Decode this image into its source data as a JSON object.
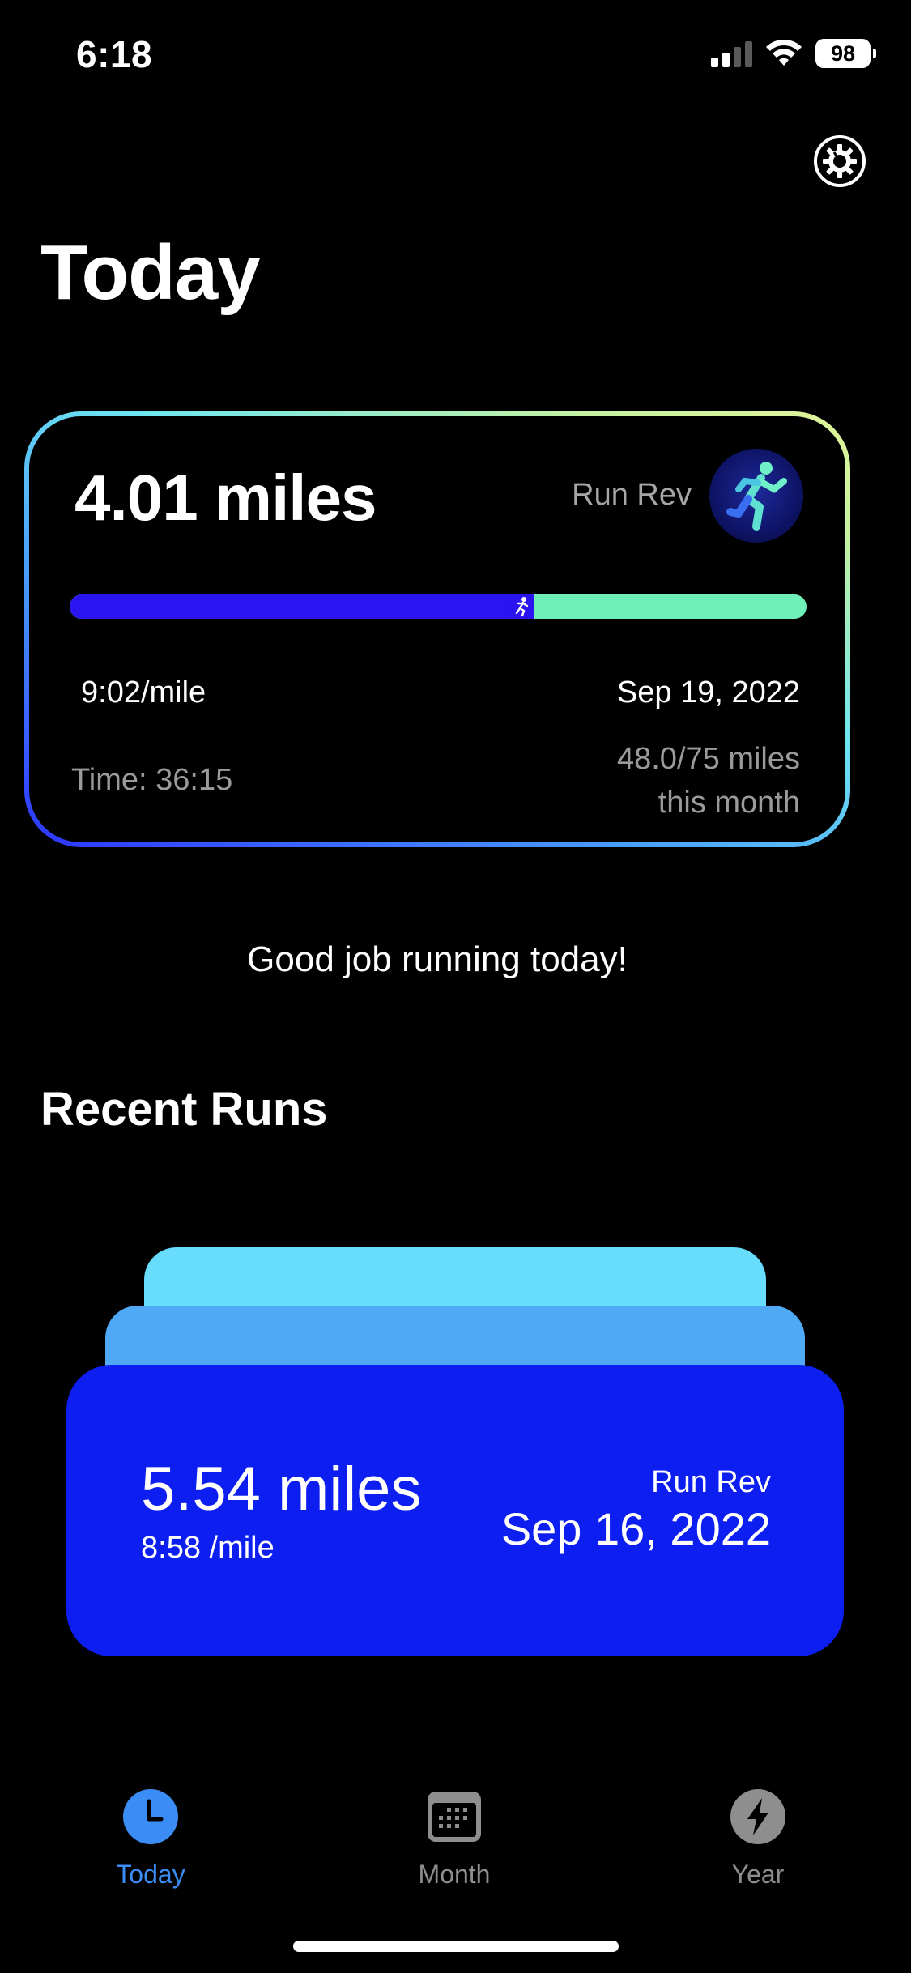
{
  "status_bar": {
    "time": "6:18",
    "battery": "98",
    "icons": [
      "cellular-signal-icon",
      "wifi-icon",
      "battery-icon"
    ]
  },
  "header": {
    "title": "Today",
    "settings_icon": "gear-icon"
  },
  "today_card": {
    "distance": "4.01 miles",
    "app_name": "Run Rev",
    "app_icon": "runner-icon",
    "goal_progress_fraction": 0.63,
    "pace": "9:02/mile",
    "date": "Sep 19, 2022",
    "time": "Time: 36:15",
    "month_progress_line1": "48.0/75 miles",
    "month_progress_line2": "this month"
  },
  "message": "Good job running today!",
  "recent_runs": {
    "title": "Recent Runs",
    "top_card": {
      "distance": "5.54 miles",
      "pace": "8:58 /mile",
      "app_name": "Run Rev",
      "date": "Sep 16, 2022"
    }
  },
  "tab_bar": {
    "tabs": [
      {
        "label": "Today",
        "icon": "clock-icon",
        "active": true
      },
      {
        "label": "Month",
        "icon": "calendar-icon",
        "active": false
      },
      {
        "label": "Year",
        "icon": "lightning-icon",
        "active": false
      }
    ]
  },
  "colors": {
    "accent": "#3c8cf5",
    "progress_done": "#2a14ef",
    "progress_remaining": "#6ff0b8",
    "run_card": "#0d1ef0",
    "stack_mid": "#4fa9f4",
    "stack_back": "#68dcfb"
  }
}
